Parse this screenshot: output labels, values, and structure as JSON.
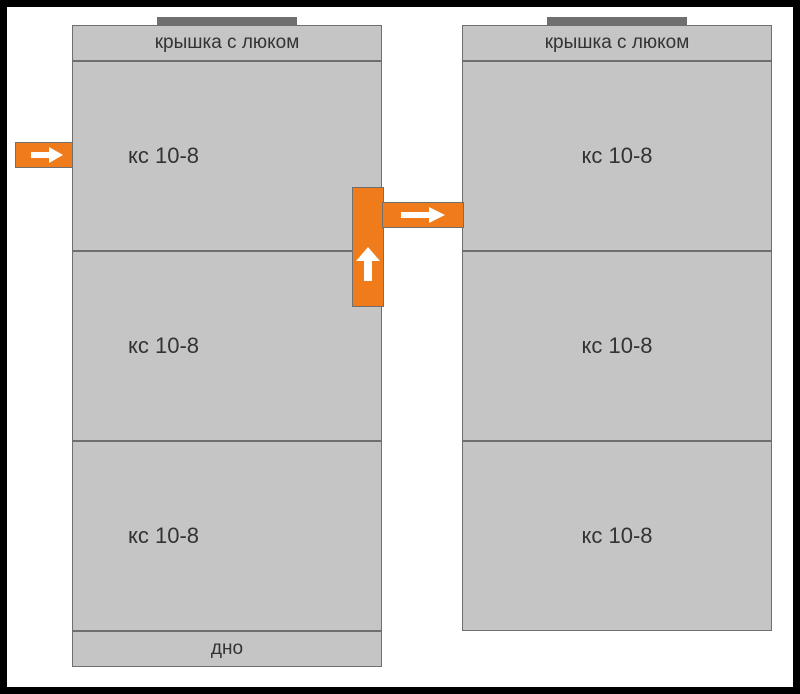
{
  "left_column": {
    "lid_label": "крышка с люком",
    "ring_labels": [
      "кс 10-8",
      "кс 10-8",
      "кс 10-8"
    ],
    "bottom_label": "дно"
  },
  "right_column": {
    "lid_label": "крышка с люком",
    "ring_labels": [
      "кс 10-8",
      "кс 10-8",
      "кс 10-8"
    ]
  }
}
